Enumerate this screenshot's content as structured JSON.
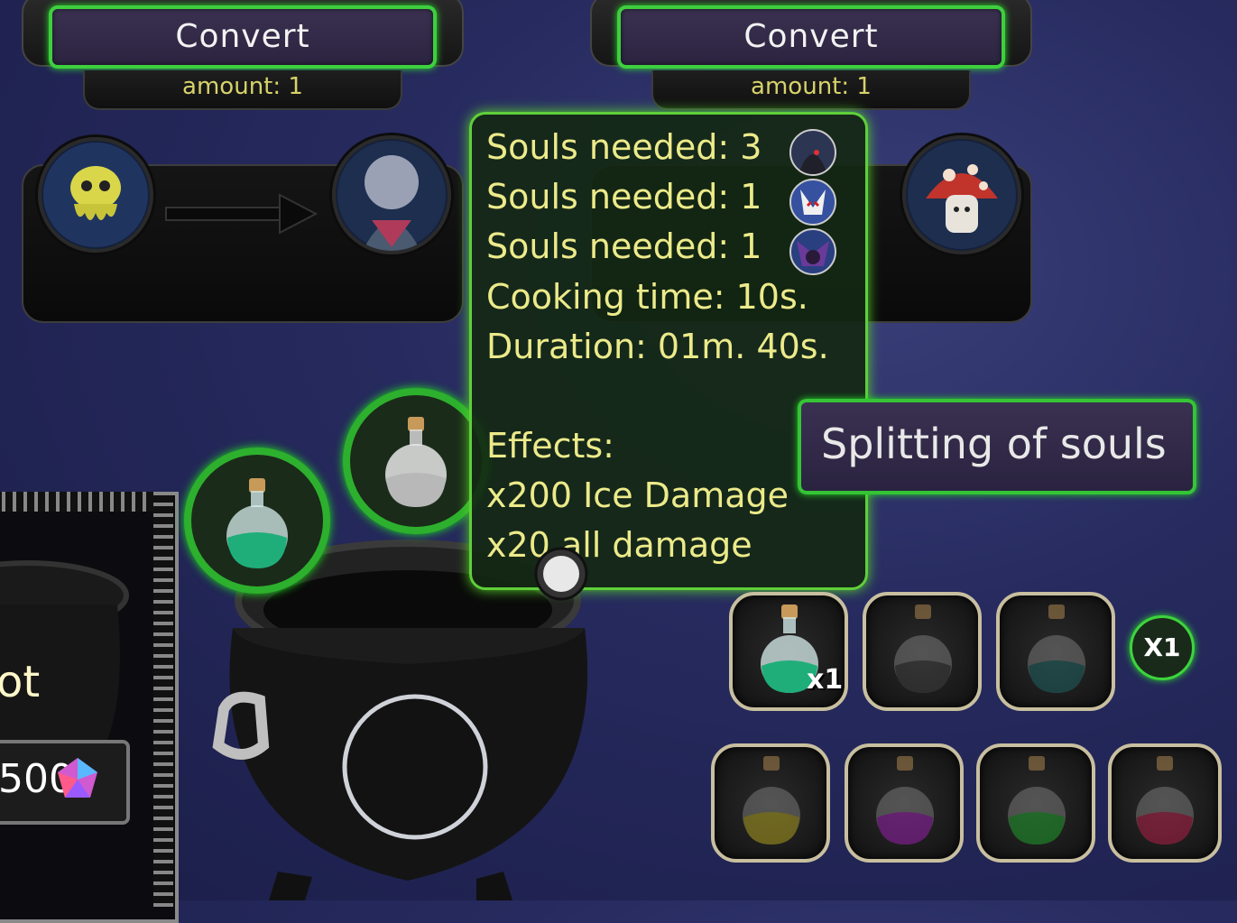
{
  "convert_panels": [
    {
      "button_label": "Convert",
      "amount_label": "amount: 1"
    },
    {
      "button_label": "Convert",
      "amount_label": "amount: 1"
    }
  ],
  "tooltip": {
    "souls": [
      {
        "text": "Souls needed: 3",
        "icon": "dark-hooded-soul-icon"
      },
      {
        "text": "Souls needed: 1",
        "icon": "fox-mask-soul-icon"
      },
      {
        "text": "Souls needed: 1",
        "icon": "purple-bat-soul-icon"
      }
    ],
    "cooking_time": "Cooking time: 10s.",
    "duration": "Duration: 01m. 40s.",
    "effects_title": "Effects:",
    "effects": [
      "x200 Ice Damage",
      "x20 all damage"
    ]
  },
  "splitting_label": "Splitting of souls",
  "potion_slots_top": [
    {
      "color": "#1fae7a",
      "count": "x1"
    },
    {
      "color": "#444444"
    },
    {
      "color": "#1f6f6f"
    }
  ],
  "multiplier_badge": "X1",
  "potion_slots_bottom": [
    {
      "color": "#8a7a1a"
    },
    {
      "color": "#7a1a8a"
    },
    {
      "color": "#1a7a2a"
    },
    {
      "color": "#8a1a3a"
    }
  ],
  "left_panel": {
    "label": "ot",
    "price": "500"
  }
}
